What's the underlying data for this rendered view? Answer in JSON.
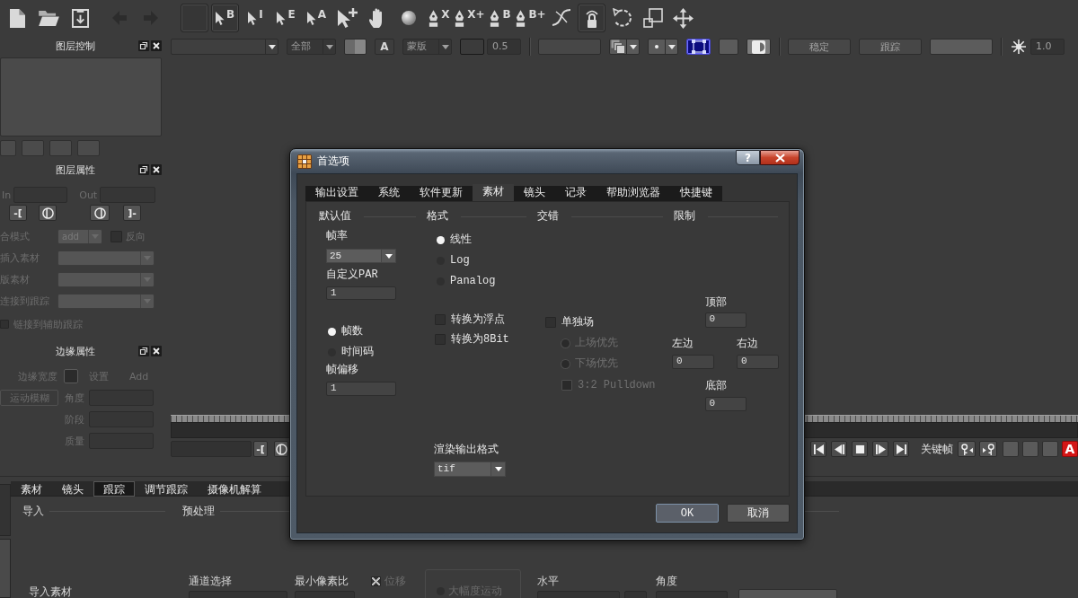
{
  "main_toolbar": {
    "file_tools": [
      {
        "kind": "new-file",
        "selected": false,
        "disabled": false
      },
      {
        "kind": "open-folder",
        "selected": false,
        "disabled": false
      },
      {
        "kind": "import",
        "selected": false,
        "disabled": false
      }
    ],
    "history_tools": [
      {
        "kind": "back",
        "selected": false,
        "disabled": true
      },
      {
        "kind": "forward",
        "selected": false,
        "disabled": true
      }
    ],
    "edit_tools": [
      {
        "kind": "blank",
        "selected": true,
        "disabled": false
      },
      {
        "kind": "pointer",
        "label": "B",
        "selected": true,
        "disabled": false
      },
      {
        "kind": "pointer",
        "label": "I",
        "selected": false,
        "disabled": false
      },
      {
        "kind": "pointer",
        "label": "E",
        "selected": false,
        "disabled": false
      },
      {
        "kind": "pointer",
        "label": "A",
        "selected": false,
        "disabled": false
      },
      {
        "kind": "pointer-plus",
        "selected": false,
        "disabled": false
      },
      {
        "kind": "hand",
        "selected": false,
        "disabled": false
      },
      {
        "kind": "ball",
        "selected": false,
        "disabled": false
      },
      {
        "kind": "pen",
        "label": "X",
        "selected": false,
        "disabled": false
      },
      {
        "kind": "pen",
        "label": "X+",
        "selected": false,
        "disabled": false
      },
      {
        "kind": "pen",
        "label": "B",
        "selected": false,
        "disabled": false
      },
      {
        "kind": "pen",
        "label": "B+",
        "selected": false,
        "disabled": false
      },
      {
        "kind": "curve",
        "selected": false,
        "disabled": false
      },
      {
        "kind": "lock",
        "selected": true,
        "disabled": false
      },
      {
        "kind": "rotate",
        "selected": false,
        "disabled": false
      },
      {
        "kind": "scale",
        "selected": false,
        "disabled": false
      },
      {
        "kind": "move",
        "selected": false,
        "disabled": false
      }
    ]
  },
  "view_toolbar": {
    "groups": [
      [
        {
          "kind": "dropdown",
          "selected": false,
          "disabled": false
        },
        {
          "kind": "dropdown",
          "value": "全部",
          "selected": false,
          "disabled": true
        },
        {
          "kind": "split-swatch",
          "selected": false,
          "disabled": false
        },
        {
          "kind": "text-button",
          "label": "A",
          "selected": false,
          "disabled": false
        },
        {
          "kind": "dropdown",
          "value": "蒙版",
          "selected": false,
          "disabled": true
        },
        {
          "kind": "swatch",
          "selected": false,
          "disabled": true
        },
        {
          "kind": "field",
          "value": "0.5",
          "selected": false,
          "disabled": true
        }
      ],
      [
        {
          "kind": "wide-button",
          "selected": false,
          "disabled": true
        },
        {
          "kind": "layers-dropdown",
          "selected": false,
          "disabled": false
        },
        {
          "kind": "dot-dropdown",
          "selected": false,
          "disabled": false
        },
        {
          "kind": "frame-button",
          "selected": true,
          "disabled": false
        },
        {
          "kind": "square-button",
          "selected": false,
          "disabled": false
        },
        {
          "kind": "contrast-button",
          "selected": false,
          "disabled": false
        }
      ],
      [
        {
          "kind": "wide-button",
          "label": "稳定",
          "selected": false,
          "disabled": true
        },
        {
          "kind": "wide-button",
          "label": "跟踪",
          "selected": false,
          "disabled": true
        },
        {
          "kind": "wide-button",
          "selected": false,
          "disabled": false
        }
      ],
      [
        {
          "kind": "sparkle-button",
          "selected": false,
          "disabled": false
        },
        {
          "kind": "field",
          "value": "1.0",
          "selected": false,
          "disabled": true
        }
      ]
    ]
  },
  "layer_controls": {
    "title": "图层控制"
  },
  "layer_properties": {
    "title": "图层属性",
    "in_label": "In",
    "out_label": "Out",
    "range_buttons": [
      {
        "kind": "text",
        "label": "-["
      },
      {
        "kind": "in-point"
      },
      {
        "kind": "out-point"
      },
      {
        "kind": "text",
        "label": "]-"
      }
    ],
    "blend_mode": {
      "label": "合模式",
      "value": "add"
    },
    "invert": {
      "label": "反向",
      "checked": false
    },
    "clip_selects": [
      {
        "label": "插入素材"
      },
      {
        "label": "版素材"
      },
      {
        "label": "连接到跟踪"
      }
    ],
    "aux_link": {
      "label": "链接到辅助跟踪",
      "checked": false
    }
  },
  "edge_properties": {
    "title": "边缘属性",
    "width_label": "边缘宽度",
    "set_label": "设置",
    "add_label": "Add",
    "motion_blur": "运动模糊",
    "fields": [
      {
        "label": "角度"
      },
      {
        "label": "阶段"
      },
      {
        "label": "质量"
      }
    ]
  },
  "timeline": {
    "range_buttons": [
      {
        "kind": "text",
        "label": "-["
      },
      {
        "kind": "in-point"
      }
    ],
    "transport": [
      {
        "kind": "prev-key"
      },
      {
        "kind": "step-back"
      },
      {
        "kind": "stop"
      },
      {
        "kind": "step-forward"
      },
      {
        "kind": "play"
      }
    ],
    "keyframe_label": "关键帧",
    "key_buttons": [
      {
        "kind": "add-key"
      },
      {
        "kind": "remove-key"
      }
    ],
    "auto_key": "A"
  },
  "bottom_panel": {
    "tabs": [
      {
        "label": "素材",
        "selected": false
      },
      {
        "label": "镜头",
        "selected": false
      },
      {
        "label": "跟踪",
        "selected": true
      },
      {
        "label": "调节跟踪",
        "selected": false
      },
      {
        "label": "摄像机解算",
        "selected": false
      }
    ],
    "import": {
      "title": "导入",
      "clip_label": "导入素材"
    },
    "preprocess": {
      "title": "预处理",
      "channel_label": "通道选择",
      "min_pixel_label": "最小像素比",
      "motion_option": {
        "label": "位移",
        "checked": true
      },
      "large_motion": {
        "label": "大幅度运动",
        "selected": false
      },
      "horizontal_label": "水平",
      "angle_label": "角度"
    }
  },
  "dialog": {
    "title": "首选项",
    "help_button": "?",
    "tabs": [
      {
        "label": "输出设置",
        "selected": false
      },
      {
        "label": "系统",
        "selected": false
      },
      {
        "label": "软件更新",
        "selected": false
      },
      {
        "label": "素材",
        "selected": true
      },
      {
        "label": "镜头",
        "selected": false
      },
      {
        "label": "记录",
        "selected": false
      },
      {
        "label": "帮助浏览器",
        "selected": false
      },
      {
        "label": "快捷键",
        "selected": false
      }
    ],
    "defaults": {
      "title": "默认值",
      "frame_rate": {
        "label": "帧率",
        "value": "25"
      },
      "custom_par": {
        "label": "自定义PAR",
        "value": "1"
      },
      "count_modes": [
        {
          "label": "帧数",
          "selected": true
        },
        {
          "label": "时间码",
          "selected": false
        }
      ],
      "frame_offset": {
        "label": "帧偏移",
        "value": "1"
      }
    },
    "format": {
      "title": "格式",
      "options": [
        {
          "label": "线性",
          "selected": true
        },
        {
          "label": "Log",
          "selected": false
        },
        {
          "label": "Panalog",
          "selected": false
        }
      ],
      "conversions": [
        {
          "label": "转换为浮点",
          "checked": false
        },
        {
          "label": "转换为8Bit",
          "checked": false
        }
      ],
      "render_format": {
        "label": "渲染输出格式",
        "value": "tif"
      }
    },
    "interlace": {
      "title": "交错",
      "separate_fields": {
        "label": "单独场",
        "checked": false
      },
      "field_order": [
        {
          "label": "上场优先",
          "selected": false,
          "disabled": true
        },
        {
          "label": "下场优先",
          "selected": false,
          "disabled": true
        }
      ],
      "pulldown": {
        "label": "3:2 Pulldown",
        "checked": false,
        "disabled": true
      }
    },
    "limits": {
      "title": "限制",
      "top": {
        "label": "顶部",
        "value": "0"
      },
      "left": {
        "label": "左边",
        "value": "0"
      },
      "right": {
        "label": "右边",
        "value": "0"
      },
      "bottom": {
        "label": "底部",
        "value": "0"
      }
    },
    "buttons": [
      {
        "label": "OK",
        "kind": "default"
      },
      {
        "label": "取消",
        "kind": "normal"
      }
    ]
  }
}
